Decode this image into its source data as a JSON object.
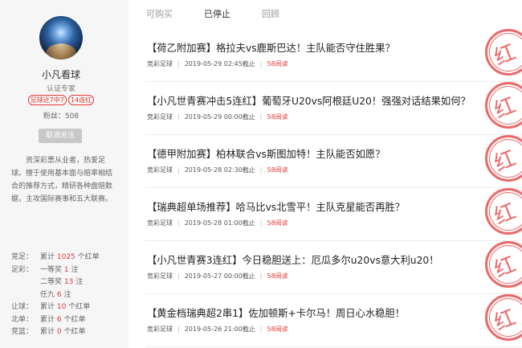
{
  "profile": {
    "name": "小凡看球",
    "certification": "认证专家",
    "tags": [
      "足球近7中7",
      "14连红"
    ],
    "fans": "粉丝：508",
    "unfollow_label": "取消关注",
    "bio": "资深彩票从业者，热爱足球。擅于使用基本面与赔率相结合的推荐方式，精研各种盘赔数据，主攻国际赛事和五大联赛。"
  },
  "stats": [
    {
      "label": "竞足：",
      "pre": "累计 ",
      "num": "1025",
      "post": " 个红单"
    },
    {
      "label": "足彩：",
      "pre": "一等奖 ",
      "num": "1",
      "post": " 注"
    },
    {
      "label": "",
      "pre": "二等奖 ",
      "num": "13",
      "post": " 注"
    },
    {
      "label": "",
      "pre": "任九 ",
      "num": "6",
      "post": " 注"
    },
    {
      "label": "让球：",
      "pre": "累计 ",
      "num": "10",
      "post": " 个红单"
    },
    {
      "label": "北单：",
      "pre": "累计 ",
      "num": "6",
      "post": " 个红单"
    },
    {
      "label": "竞篮：",
      "pre": "累计 ",
      "num": "0",
      "post": " 个红单"
    }
  ],
  "tabs": [
    "可购买",
    "已停止",
    "回顾"
  ],
  "items": [
    {
      "title": "【荷乙附加赛】格拉夫vs鹿斯巴达！主队能否守住胜果？",
      "category": "竞彩足球",
      "time": "2019-05-29 02:45截止",
      "views": "58阅读",
      "stamp": "红"
    },
    {
      "title": "【小凡世青赛冲击5连红】葡萄牙U20vs阿根廷U20！强强对话结果如何？",
      "category": "竞彩足球",
      "time": "2019-05-29 00:00截止",
      "views": "58阅读",
      "stamp": "红"
    },
    {
      "title": "【德甲附加赛】柏林联合vs斯图加特！主队能否如愿？",
      "category": "竞彩足球",
      "time": "2019-05-28 02:30截止",
      "views": "58阅读",
      "stamp": "红"
    },
    {
      "title": "【瑞典超单场推荐】哈马比vs北雪平！主队克星能否再胜？",
      "category": "竞彩足球",
      "time": "2019-05-28 01:00截止",
      "views": "58阅读",
      "stamp": "红"
    },
    {
      "title": "【小凡世青赛3连红】今日稳胆送上：厄瓜多尔u20vs意大利u20！",
      "category": "竞彩足球",
      "time": "2019-05-27 00:00截止",
      "views": "58阅读",
      "stamp": "红"
    },
    {
      "title": "【黄金档瑞典超2串1】佐加顿斯+卡尔马！周日心水稳胆！",
      "category": "竞彩足球",
      "time": "2019-05-26 21:00截止",
      "views": "58阅读",
      "stamp": "红"
    }
  ],
  "colors": {
    "accent_red": "#e23a3a",
    "stamp_red": "#e9504f",
    "sidebar_bg": "#f6f6f6"
  }
}
